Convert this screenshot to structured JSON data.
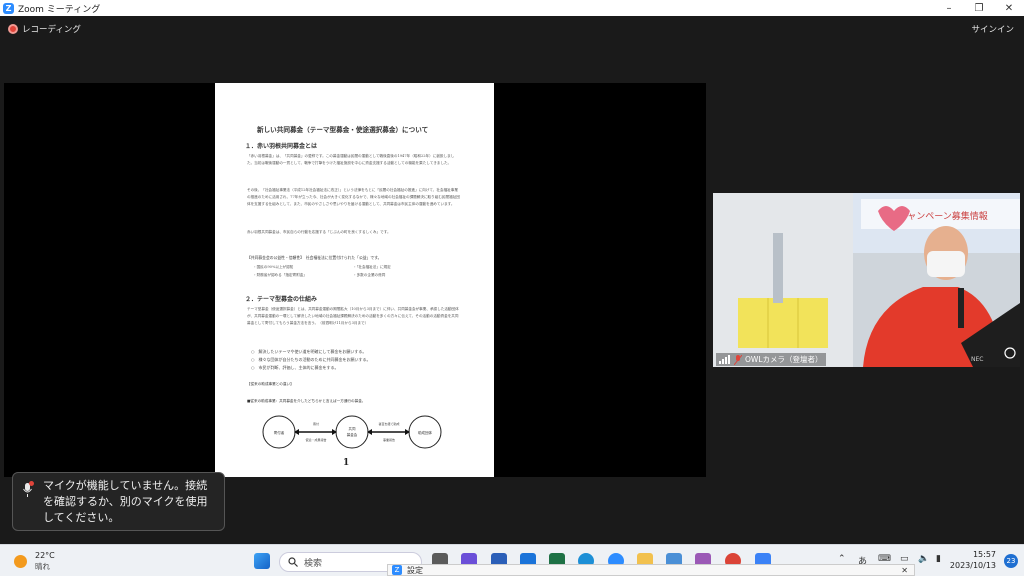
{
  "window": {
    "title": "Zoom ミーティング",
    "controls": [
      "–",
      "❐",
      "✕"
    ]
  },
  "topbar": {
    "recording_label": "レコーディング",
    "signin_label": "サインイン"
  },
  "document": {
    "title": "新しい共同募金（テーマ型募金・使途選択募金）について",
    "section1_heading": "１．赤い羽根共同募金とは",
    "section1_p1": "「赤い羽根募金」は、「共同募金」の愛称です。この募金運動は民間の運動として戦後直後の1947年（昭和22年）に創設しました。当初は戦後運動の一貫として、戦争で打撃をうけた福祉施設を中心に資金支援する活動としての機能を果たしてきました。",
    "section1_p2": "その後、「社会福祉事業法（平成12年社会福祉法に改正）」という法律をもとに「民間の社会福祉の推進」に向けて、社会福祉事業の推進のために活用され、77年が立った今、社会が大きく変化するなかで、様々な地域の社会福祉の課題解決に取り組む民間福祉団体を支援する仕組みとして、また、市民のやさしさや思いやりを届ける運動として、共同募金は市民主体の運動を進めています。",
    "section1_p3": "赤い羽根共同募金は、市民自らの行動を応援する「じぶんの町を良くするしくみ」です。",
    "features_heading": "【共同募金会の公益性・信頼性】　社会福祉法に位置付けられた「公益」です。",
    "features": [
      "・国民の90%以上が認知",
      "・「社会福祉法」に規定",
      "・財務省が認める「指定寄附金」",
      "・多数の企業の賛同"
    ],
    "section2_heading": "２．テーマ型募金の仕組み",
    "section2_p1": "テーマ型募金（使途選択募金）とは、共同募金運動の期間拡大（10月から3月まで）に伴い、共同募金会が事業、承認した活動団体が、共同募金運動の一環として解決したい地域の社会福祉課題解決のための活動を多くの方々に伝えて、その活動の活動資金を共同募金として寄付してもらう募金方法を言う。（前週明け11月から3月まで）",
    "bullets": [
      "○　解決したいテーマや使い道を明確にして募金をお願いする。",
      "○　様々な団体が自分たちの活動のために共同募金をお願いする。",
      "○　市民が判断、評価し、主体的に募金をする。"
    ],
    "prev_heading": "【従来の助成事業との違い】",
    "prev_note": "■従来の助成事業：共同募金を介したどちらかと言えば一方通行の募金。",
    "diagram": {
      "left": "寄付者",
      "center_top": "共同",
      "center_bottom": "募金会",
      "right": "助成団体",
      "arrow1_top": "寄付",
      "arrow1_bottom": "使途・成果報告",
      "arrow2_top": "審査を経て助成",
      "arrow2_bottom": "事業報告"
    },
    "page_number": "1"
  },
  "camera": {
    "label": "OWLカメラ（登壇者）",
    "laptop_brand": "NEC",
    "banner": "キャンペーン募集情報"
  },
  "toast": {
    "message": "マイクが機能していません。接続を確認するか、別のマイクを使用してください。"
  },
  "taskbar": {
    "temperature": "22°C",
    "condition": "晴れ",
    "search_placeholder": "検索",
    "time": "15:57",
    "date": "2023/10/13",
    "notification_count": "23",
    "ime_label": "あ"
  },
  "popup": {
    "label": "設定"
  },
  "colors": {
    "zoom_blue": "#2d8cff",
    "record_red": "#e0443a",
    "stage_bg": "#000000",
    "app_bg": "#1a1a1a"
  }
}
